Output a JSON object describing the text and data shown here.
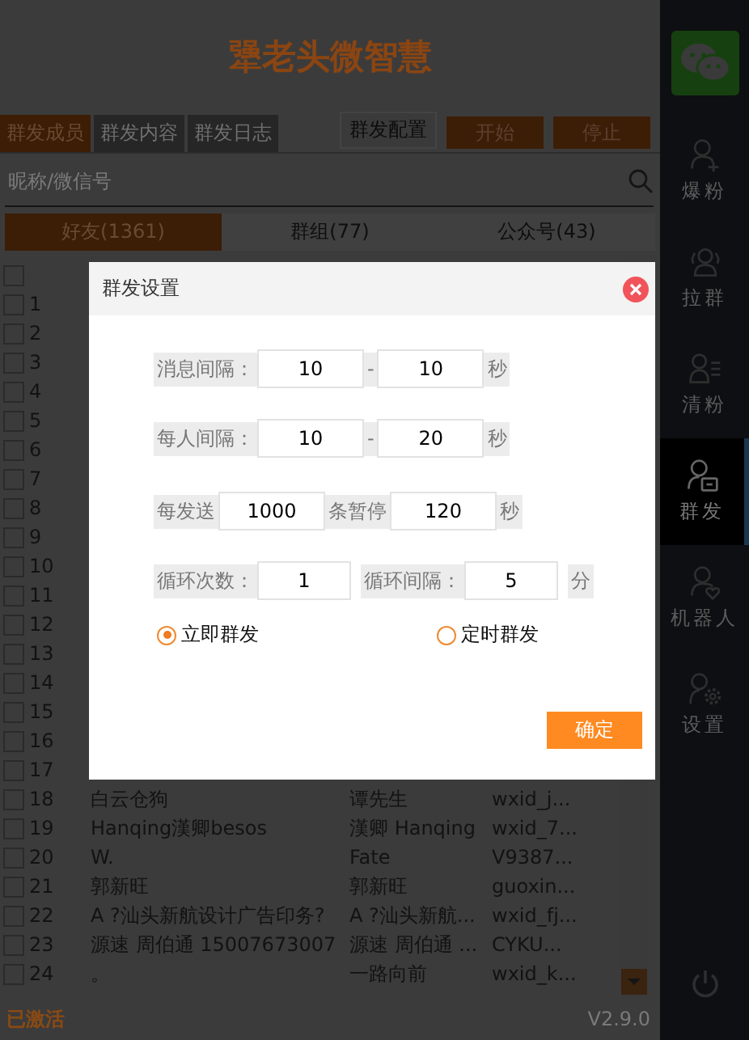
{
  "app": {
    "title": "犟老头微智慧",
    "tabs": [
      {
        "label": "群发成员",
        "selected": true
      },
      {
        "label": "群发内容",
        "selected": false
      },
      {
        "label": "群发日志",
        "selected": false
      }
    ],
    "config_button": "群发配置",
    "start_button": "开始",
    "stop_button": "停止",
    "search": {
      "placeholder": "昵称/微信号"
    },
    "list_tabs": [
      {
        "label": "好友(1361)",
        "selected": true
      },
      {
        "label": "群组(77)",
        "selected": false
      },
      {
        "label": "公众号(43)",
        "selected": false
      }
    ],
    "all_checked": false,
    "rows": [
      {
        "number": "1",
        "checked": false
      },
      {
        "number": "2",
        "checked": false
      },
      {
        "number": "3",
        "checked": false
      },
      {
        "number": "4",
        "checked": false
      },
      {
        "number": "5",
        "checked": false
      },
      {
        "number": "6",
        "checked": false
      },
      {
        "number": "7",
        "checked": false
      },
      {
        "number": "8",
        "checked": false
      },
      {
        "number": "9",
        "checked": false
      },
      {
        "number": "10",
        "checked": false
      },
      {
        "number": "11",
        "checked": false
      },
      {
        "number": "12",
        "checked": false
      },
      {
        "number": "13",
        "checked": false
      },
      {
        "number": "14",
        "checked": false
      },
      {
        "number": "15",
        "checked": false
      },
      {
        "number": "16",
        "checked": false
      },
      {
        "number": "17",
        "checked": false
      },
      {
        "number": "18",
        "checked": false,
        "nickname": "白云仓狗",
        "remark": "谭先生",
        "wxid": "wxid_j..."
      },
      {
        "number": "19",
        "checked": false,
        "nickname": "Hanqing漢卿besos",
        "remark": "漢卿 Hanqing",
        "wxid": "wxid_7..."
      },
      {
        "number": "20",
        "checked": false,
        "nickname": "W.",
        "remark": "Fate",
        "wxid": "V9387..."
      },
      {
        "number": "21",
        "checked": false,
        "nickname": "郭新旺",
        "remark": "郭新旺",
        "wxid": "guoxin..."
      },
      {
        "number": "22",
        "checked": false,
        "nickname": "A ?汕头新航设计广告印务?",
        "remark": "A ?汕头新航...",
        "wxid": "wxid_fj..."
      },
      {
        "number": "23",
        "checked": false,
        "nickname": "源速 周伯通 15007673007",
        "remark": "源速 周伯通 ...",
        "wxid": "CYKU..."
      },
      {
        "number": "24",
        "checked": false,
        "nickname": "。",
        "remark": "一路向前",
        "wxid": "wxid_k..."
      }
    ],
    "status": "已激活",
    "version": "V2.9.0"
  },
  "sidebar": {
    "items": [
      {
        "label": "爆粉",
        "kind": "add",
        "selected": false
      },
      {
        "label": "拉群",
        "kind": "group",
        "selected": false
      },
      {
        "label": "清粉",
        "kind": "list",
        "selected": false
      },
      {
        "label": "群发",
        "kind": "message",
        "selected": true
      },
      {
        "label": "机器人",
        "kind": "heart",
        "selected": false
      },
      {
        "label": "设置",
        "kind": "gear",
        "selected": false
      }
    ]
  },
  "dialog": {
    "title": "群发设置",
    "rows": [
      [
        {
          "kind": "label",
          "text": "消息间隔："
        },
        {
          "kind": "input",
          "value": "10"
        },
        {
          "kind": "label",
          "text": "-"
        },
        {
          "kind": "input",
          "value": "10"
        },
        {
          "kind": "label",
          "text": "秒"
        }
      ],
      [
        {
          "kind": "label",
          "text": "每人间隔："
        },
        {
          "kind": "input",
          "value": "10"
        },
        {
          "kind": "label",
          "text": "-"
        },
        {
          "kind": "input",
          "value": "20"
        },
        {
          "kind": "label",
          "text": "秒"
        }
      ],
      [
        {
          "kind": "label",
          "text": "每发送"
        },
        {
          "kind": "input",
          "value": "1000"
        },
        {
          "kind": "label",
          "text": "条暂停"
        },
        {
          "kind": "input",
          "value": "120"
        },
        {
          "kind": "label",
          "text": "秒"
        }
      ],
      [
        {
          "kind": "label",
          "text": "循环次数："
        },
        {
          "kind": "input",
          "value": "1"
        },
        {
          "kind": "gap"
        },
        {
          "kind": "label",
          "text": "循环间隔："
        },
        {
          "kind": "input",
          "value": "5"
        },
        {
          "kind": "gap"
        },
        {
          "kind": "label",
          "text": "分"
        }
      ]
    ],
    "modes": [
      {
        "label": "立即群发",
        "selected": true
      },
      {
        "label": "定时群发",
        "selected": false
      }
    ],
    "ok_button": "确定"
  }
}
